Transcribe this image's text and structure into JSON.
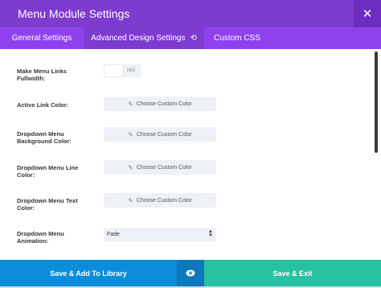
{
  "header": {
    "title": "Menu Module Settings",
    "close_icon": "close-icon"
  },
  "tabs": [
    {
      "label": "General Settings"
    },
    {
      "label": "Advanced Design Settings",
      "reset_icon": "reset-icon"
    },
    {
      "label": "Custom CSS"
    }
  ],
  "settings": {
    "fullwidth": {
      "label": "Make Menu Links Fullwidth:",
      "toggle_text": "NO"
    },
    "active_link_color": {
      "label": "Active Link Color:",
      "button": "Choose Custom Color"
    },
    "dropdown_bg_color": {
      "label": "Dropdown Menu Background Color:",
      "button": "Choose Custom Color"
    },
    "dropdown_line_color": {
      "label": "Dropdown Menu Line Color:",
      "button": "Choose Custom Color"
    },
    "dropdown_text_color": {
      "label": "Dropdown Menu Text Color:",
      "button": "Choose Custom Color"
    },
    "dropdown_animation": {
      "label": "Dropdown Menu Animation:",
      "value": "Fade"
    }
  },
  "footer": {
    "save_library": "Save & Add To Library",
    "save_exit": "Save & Exit",
    "preview_icon": "eye-icon"
  },
  "colors": {
    "header": "#7e3bd0",
    "tabs": "#8f42ec",
    "library_button": "#0c8dd9",
    "exit_button": "#28c1a2"
  }
}
